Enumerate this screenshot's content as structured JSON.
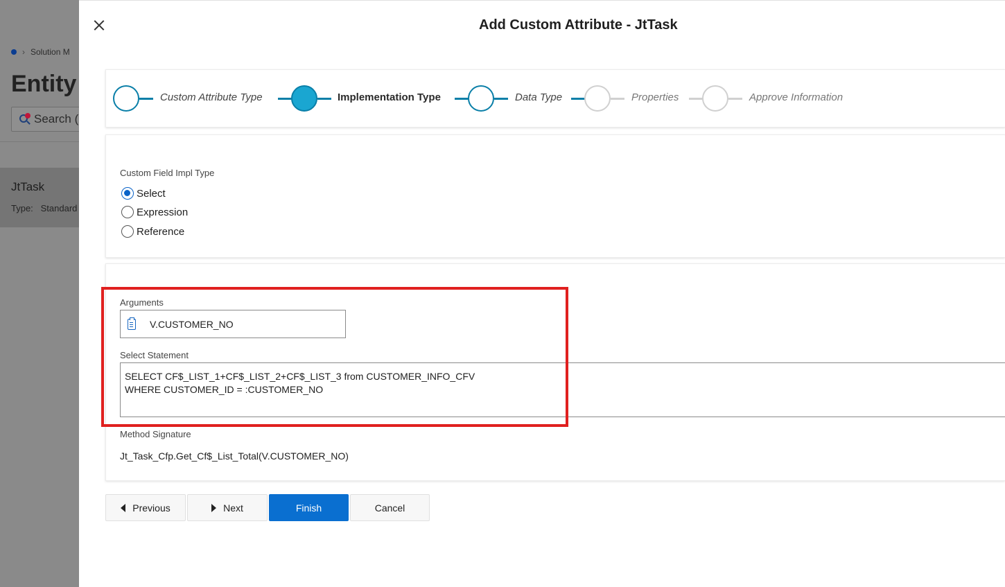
{
  "background": {
    "breadcrumb": "Solution M",
    "title": "Entity",
    "search_label": "Search (",
    "card_title": "JtTask",
    "card_type_label": "Type:",
    "card_type_value": "Standard"
  },
  "dialog": {
    "title": "Add Custom Attribute - JtTask"
  },
  "wizard": {
    "steps": [
      {
        "label": "Custom Attribute Type",
        "state": "done"
      },
      {
        "label": "Implementation Type",
        "state": "active"
      },
      {
        "label": "Data Type",
        "state": "done"
      },
      {
        "label": "Properties",
        "state": "future"
      },
      {
        "label": "Approve Information",
        "state": "future"
      }
    ]
  },
  "impl_type": {
    "label": "Custom Field Impl Type",
    "options": [
      "Select",
      "Expression",
      "Reference"
    ],
    "selected": "Select"
  },
  "arguments": {
    "label": "Arguments",
    "value": "V.CUSTOMER_NO"
  },
  "select_statement": {
    "label": "Select Statement",
    "line1": "SELECT CF$_LIST_1+CF$_LIST_2+CF$_LIST_3 from CUSTOMER_INFO_CFV",
    "line2": "WHERE CUSTOMER_ID = :CUSTOMER_NO"
  },
  "method_signature": {
    "label": "Method Signature",
    "value": "Jt_Task_Cfp.Get_Cf$_List_Total(V.CUSTOMER_NO)"
  },
  "buttons": {
    "previous": "Previous",
    "next": "Next",
    "finish": "Finish",
    "cancel": "Cancel"
  },
  "colors": {
    "accent": "#0a7fa8",
    "active_step": "#1aa6d1",
    "primary_button": "#0a6fd0",
    "highlight": "#e0201f"
  }
}
